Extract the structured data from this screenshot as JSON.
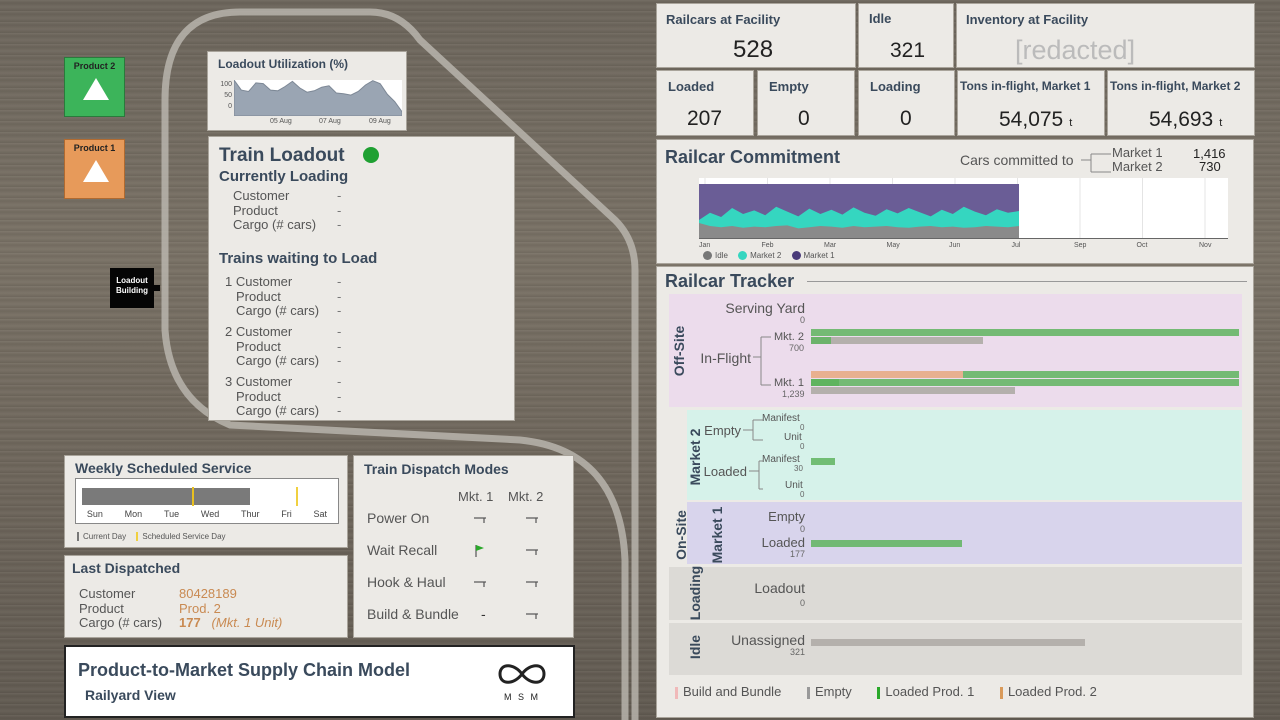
{
  "map": {
    "product2_label": "Product 2",
    "product1_label": "Product 1",
    "loadout_building_label": "Loadout Building",
    "colors": {
      "product2": "#3cb45a",
      "product1": "#e79a5a",
      "track": "#b9b6b0"
    }
  },
  "utilization": {
    "title": "Loadout Utilization (%)",
    "y_ticks": [
      "100",
      "50",
      "0"
    ],
    "x_ticks": [
      "05 Aug",
      "07 Aug",
      "09 Aug"
    ],
    "chart_data": {
      "type": "area",
      "ylim": [
        0,
        100
      ],
      "values": [
        100,
        72,
        68,
        92,
        90,
        72,
        70,
        82,
        96,
        78,
        66,
        70,
        80,
        84,
        64,
        62,
        58,
        68,
        86,
        98,
        90,
        60,
        40,
        12
      ],
      "color": "#9aa5b3"
    }
  },
  "train_loadout": {
    "title": "Train Loadout",
    "status_color": "#1fa032",
    "currently_loading": "Currently Loading",
    "customer": "Customer",
    "product": "Product",
    "cargo": "Cargo (# cars)",
    "dash": "-",
    "waiting_title": "Trains waiting to Load",
    "waiting": [
      {
        "num": "1",
        "customer": "Customer",
        "product": "Product",
        "cargo": "Cargo (# cars)"
      },
      {
        "num": "2",
        "customer": "Customer",
        "product": "Product",
        "cargo": "Cargo (# cars)"
      },
      {
        "num": "3",
        "customer": "Customer",
        "product": "Product",
        "cargo": "Cargo (# cars)"
      }
    ]
  },
  "weekly": {
    "title": "Weekly Scheduled Service",
    "days": [
      "Sun",
      "Mon",
      "Tue",
      "Wed",
      "Thur",
      "Fri",
      "Sat"
    ],
    "current_day_label": "Current Day",
    "scheduled_label": "Scheduled Service Day",
    "progress_fraction": 0.64
  },
  "last_dispatched": {
    "title": "Last Dispatched",
    "customer_label": "Customer",
    "customer_value": "80428189",
    "product_label": "Product",
    "product_value": "Prod. 2",
    "cargo_label": "Cargo (# cars)",
    "cargo_value": "177",
    "cargo_note": "(Mkt. 1 Unit)"
  },
  "dispatch_modes": {
    "title": "Train Dispatch Modes",
    "col1": "Mkt. 1",
    "col2": "Mkt. 2",
    "rows": [
      {
        "label": "Power On",
        "m1": "flag-down-icon",
        "m2": "flag-down-icon"
      },
      {
        "label": "Wait Recall",
        "m1": "flag-up-icon",
        "m2": "flag-down-icon"
      },
      {
        "label": "Hook & Haul",
        "m1": "flag-down-icon",
        "m2": "flag-down-icon"
      },
      {
        "label": "Build & Bundle",
        "m1": "-",
        "m2": "flag-down-icon"
      }
    ]
  },
  "model": {
    "title": "Product-to-Market Supply Chain Model",
    "subtitle": "Railyard View",
    "logo_text": "M S M"
  },
  "kpis": {
    "railcars_label": "Railcars at Facility",
    "railcars_value": "528",
    "idle_label": "Idle",
    "idle_value": "321",
    "inventory_label": "Inventory at Facility",
    "inventory_value": "[redacted]",
    "loaded_label": "Loaded",
    "loaded_value": "207",
    "empty_label": "Empty",
    "empty_value": "0",
    "loading_label": "Loading",
    "loading_value": "0",
    "tons1_label": "Tons in-flight, Market 1",
    "tons1_value": "54,075",
    "tons2_label": "Tons in-flight, Market 2",
    "tons2_value": "54,693",
    "tons_unit": "t"
  },
  "commitment": {
    "title": "Railcar Commitment",
    "cars_committed_label": "Cars committed to",
    "market1_label": "Market 1",
    "market1_value": "1,416",
    "market2_label": "Market 2",
    "market2_value": "730",
    "months": [
      "Jan",
      "Feb",
      "Mar",
      "May",
      "Jun",
      "Jul",
      "Sep",
      "Oct",
      "Nov"
    ],
    "legend": [
      {
        "name": "Idle",
        "color": "#777777"
      },
      {
        "name": "Market 2",
        "color": "#35d6c0"
      },
      {
        "name": "Market 1",
        "color": "#4a3b7a"
      }
    ],
    "chart_data": {
      "type": "area",
      "x": [
        "Jan",
        "Feb",
        "Mar",
        "May",
        "Jun",
        "Jul",
        "Sep",
        "Oct",
        "Nov"
      ],
      "series": [
        {
          "name": "Idle",
          "values": [
            0.25,
            0.2,
            0.18,
            0.2,
            0.17,
            0.19,
            0.18,
            0.2,
            0.21,
            0.16,
            0.18,
            0.2,
            0.19,
            0.17,
            0.2,
            0.18,
            0.19,
            0.2,
            0.18,
            0.17,
            0.19,
            0.2,
            0.18,
            0.19,
            0.17,
            0.18,
            0.2,
            0.19,
            0.18,
            0.2
          ]
        },
        {
          "name": "Market 2",
          "values": [
            0.3,
            0.42,
            0.35,
            0.5,
            0.4,
            0.46,
            0.38,
            0.52,
            0.44,
            0.36,
            0.49,
            0.4,
            0.47,
            0.39,
            0.51,
            0.42,
            0.37,
            0.48,
            0.41,
            0.5,
            0.43,
            0.36,
            0.47,
            0.4,
            0.52,
            0.44,
            0.38,
            0.48,
            0.42,
            0.45
          ]
        },
        {
          "name": "Market 1",
          "values": [
            0.9,
            0.9,
            0.9,
            0.9,
            0.9,
            0.9,
            0.9,
            0.9,
            0.9,
            0.9,
            0.9,
            0.9,
            0.9,
            0.9,
            0.9,
            0.9,
            0.9,
            0.9,
            0.9,
            0.9,
            0.9,
            0.9,
            0.9,
            0.9,
            0.9,
            0.9,
            0.9,
            0.9,
            0.9,
            0.9
          ]
        }
      ],
      "ylim": [
        0,
        1
      ]
    }
  },
  "tracker": {
    "title": "Railcar Tracker",
    "off_site_label": "Off-Site",
    "on_site_label": "On-Site",
    "market2_group": "Market 2",
    "market1_group": "Market 1",
    "loading_group": "Loading",
    "idle_group": "Idle",
    "serving_yard_label": "Serving Yard",
    "serving_yard_value": "0",
    "in_flight_label": "In-Flight",
    "mkt2_label": "Mkt. 2",
    "mkt2_value": "700",
    "mkt1_label": "Mkt. 1",
    "mkt1_value": "1,239",
    "m2_empty_label": "Empty",
    "m2_empty_manifest_label": "Manifest",
    "m2_empty_manifest_value": "0",
    "m2_empty_unit_label": "Unit",
    "m2_empty_unit_value": "0",
    "m2_loaded_label": "Loaded",
    "m2_loaded_manifest_label": "Manifest",
    "m2_loaded_manifest_value": "30",
    "m2_loaded_unit_label": "Unit",
    "m2_loaded_unit_value": "0",
    "m1_empty_label": "Empty",
    "m1_empty_value": "0",
    "m1_loaded_label": "Loaded",
    "m1_loaded_value": "177",
    "loadout_label": "Loadout",
    "loadout_value": "0",
    "unassigned_label": "Unassigned",
    "unassigned_value": "321",
    "colors": {
      "offsite_bg": "#ecdcec",
      "m2_bg": "#d6f2ea",
      "m1_bg": "#d8d4ec",
      "loading_bg": "#dcdad6",
      "idle_bg": "#dcdad6",
      "green": "#5fb45f",
      "gray": "#b4b0ac",
      "pink": "#f0b9b9",
      "orange": "#e0a070"
    },
    "legend": [
      {
        "name": "Build and Bundle",
        "color": "#f0b9b9"
      },
      {
        "name": "Empty",
        "color": "#999999"
      },
      {
        "name": "Loaded Prod. 1",
        "color": "#2aa82a"
      },
      {
        "name": "Loaded Prod. 2",
        "color": "#d99a5a"
      }
    ]
  }
}
